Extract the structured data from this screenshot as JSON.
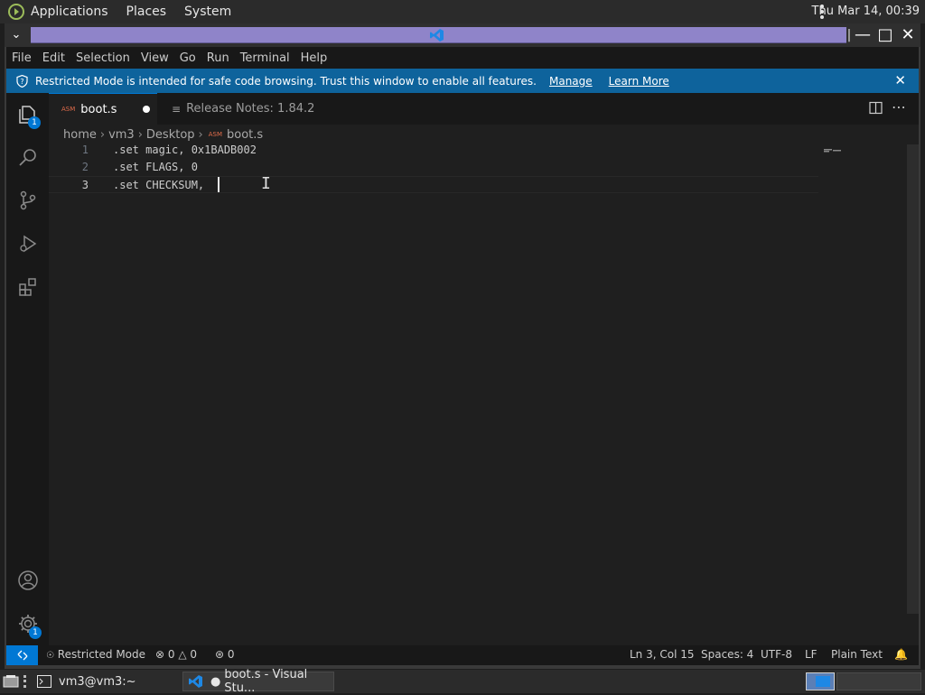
{
  "top_panel": {
    "menus": [
      "Applications",
      "Places",
      "System"
    ],
    "clock": "Thu Mar 14, 00:39"
  },
  "menubar": [
    "File",
    "Edit",
    "Selection",
    "View",
    "Go",
    "Run",
    "Terminal",
    "Help"
  ],
  "banner": {
    "text": "Restricted Mode is intended for safe code browsing. Trust this window to enable all features.",
    "manage": "Manage",
    "learn_more": "Learn More"
  },
  "activity": {
    "explorer_badge": "1",
    "settings_badge": "1"
  },
  "tabs": [
    {
      "label": "boot.s",
      "icon_text": "ASM"
    },
    {
      "label": "Release Notes: 1.84.2"
    }
  ],
  "breadcrumb": {
    "parts": [
      "home",
      "vm3",
      "Desktop"
    ],
    "file_icon_text": "ASM",
    "file": "boot.s"
  },
  "editor": {
    "lines": [
      {
        "num": "1",
        "code": ".set magic, 0x1BADB002"
      },
      {
        "num": "2",
        "code": ".set FLAGS, 0"
      },
      {
        "num": "3",
        "code": ".set CHECKSUM,"
      }
    ]
  },
  "statusbar": {
    "restricted": "Restricted Mode",
    "errors": "0",
    "warnings": "0",
    "ports": "0",
    "position": "Ln 3, Col 15",
    "spaces": "Spaces: 4",
    "encoding": "UTF-8",
    "eol": "LF",
    "language": "Plain Text"
  },
  "taskbar": {
    "terminal": "vm3@vm3:~",
    "vscode": "boot.s - Visual Stu..."
  },
  "colors": {
    "accent": "#0078d4",
    "banner": "#0e639c",
    "title_fill": "#8f84c9",
    "asm_icon": "#e06c4b"
  }
}
